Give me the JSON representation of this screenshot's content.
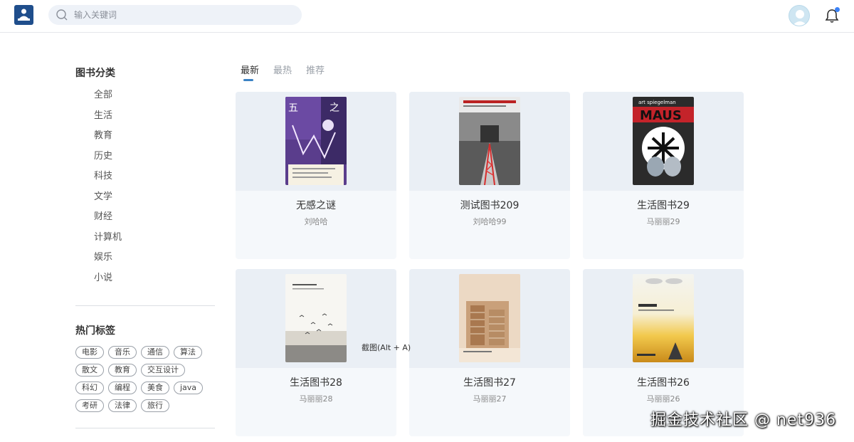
{
  "header": {
    "search_placeholder": "输入关键词",
    "logo_icon": "library-logo-icon",
    "avatar_icon": "user-avatar-icon",
    "bell_icon": "notification-bell-icon",
    "notification_dot_color": "#3b82f6"
  },
  "sidebar": {
    "category_title": "图书分类",
    "categories": [
      "全部",
      "生活",
      "教育",
      "历史",
      "科技",
      "文学",
      "财经",
      "计算机",
      "娱乐",
      "小说"
    ],
    "tag_title": "热门标签",
    "tags": [
      [
        "电影",
        "音乐",
        "通信",
        "算法"
      ],
      [
        "散文",
        "教育",
        "交互设计"
      ],
      [
        "科幻",
        "编程",
        "美食",
        "java"
      ],
      [
        "考研",
        "法律",
        "旅行"
      ]
    ]
  },
  "tabs": [
    {
      "label": "最新",
      "active": true
    },
    {
      "label": "最热",
      "active": false
    },
    {
      "label": "推荐",
      "active": false
    }
  ],
  "books": [
    {
      "title": "无感之谜",
      "author": "刘哈哈",
      "cover": "purple"
    },
    {
      "title": "测试图书209",
      "author": "刘哈哈99",
      "cover": "rail"
    },
    {
      "title": "生活图书29",
      "author": "马丽丽29",
      "cover": "maus"
    },
    {
      "title": "生活图书28",
      "author": "马丽丽28",
      "cover": "birds"
    },
    {
      "title": "生活图书27",
      "author": "马丽丽27",
      "cover": "building"
    },
    {
      "title": "生活图书26",
      "author": "马丽丽26",
      "cover": "sunset"
    }
  ],
  "tooltip": "截图(Alt + A)",
  "watermark": "掘金技术社区 @ net936",
  "colors": {
    "accent": "#3b82c4",
    "logo": "#1f4e8c",
    "card_bg": "#f5f8fb"
  }
}
